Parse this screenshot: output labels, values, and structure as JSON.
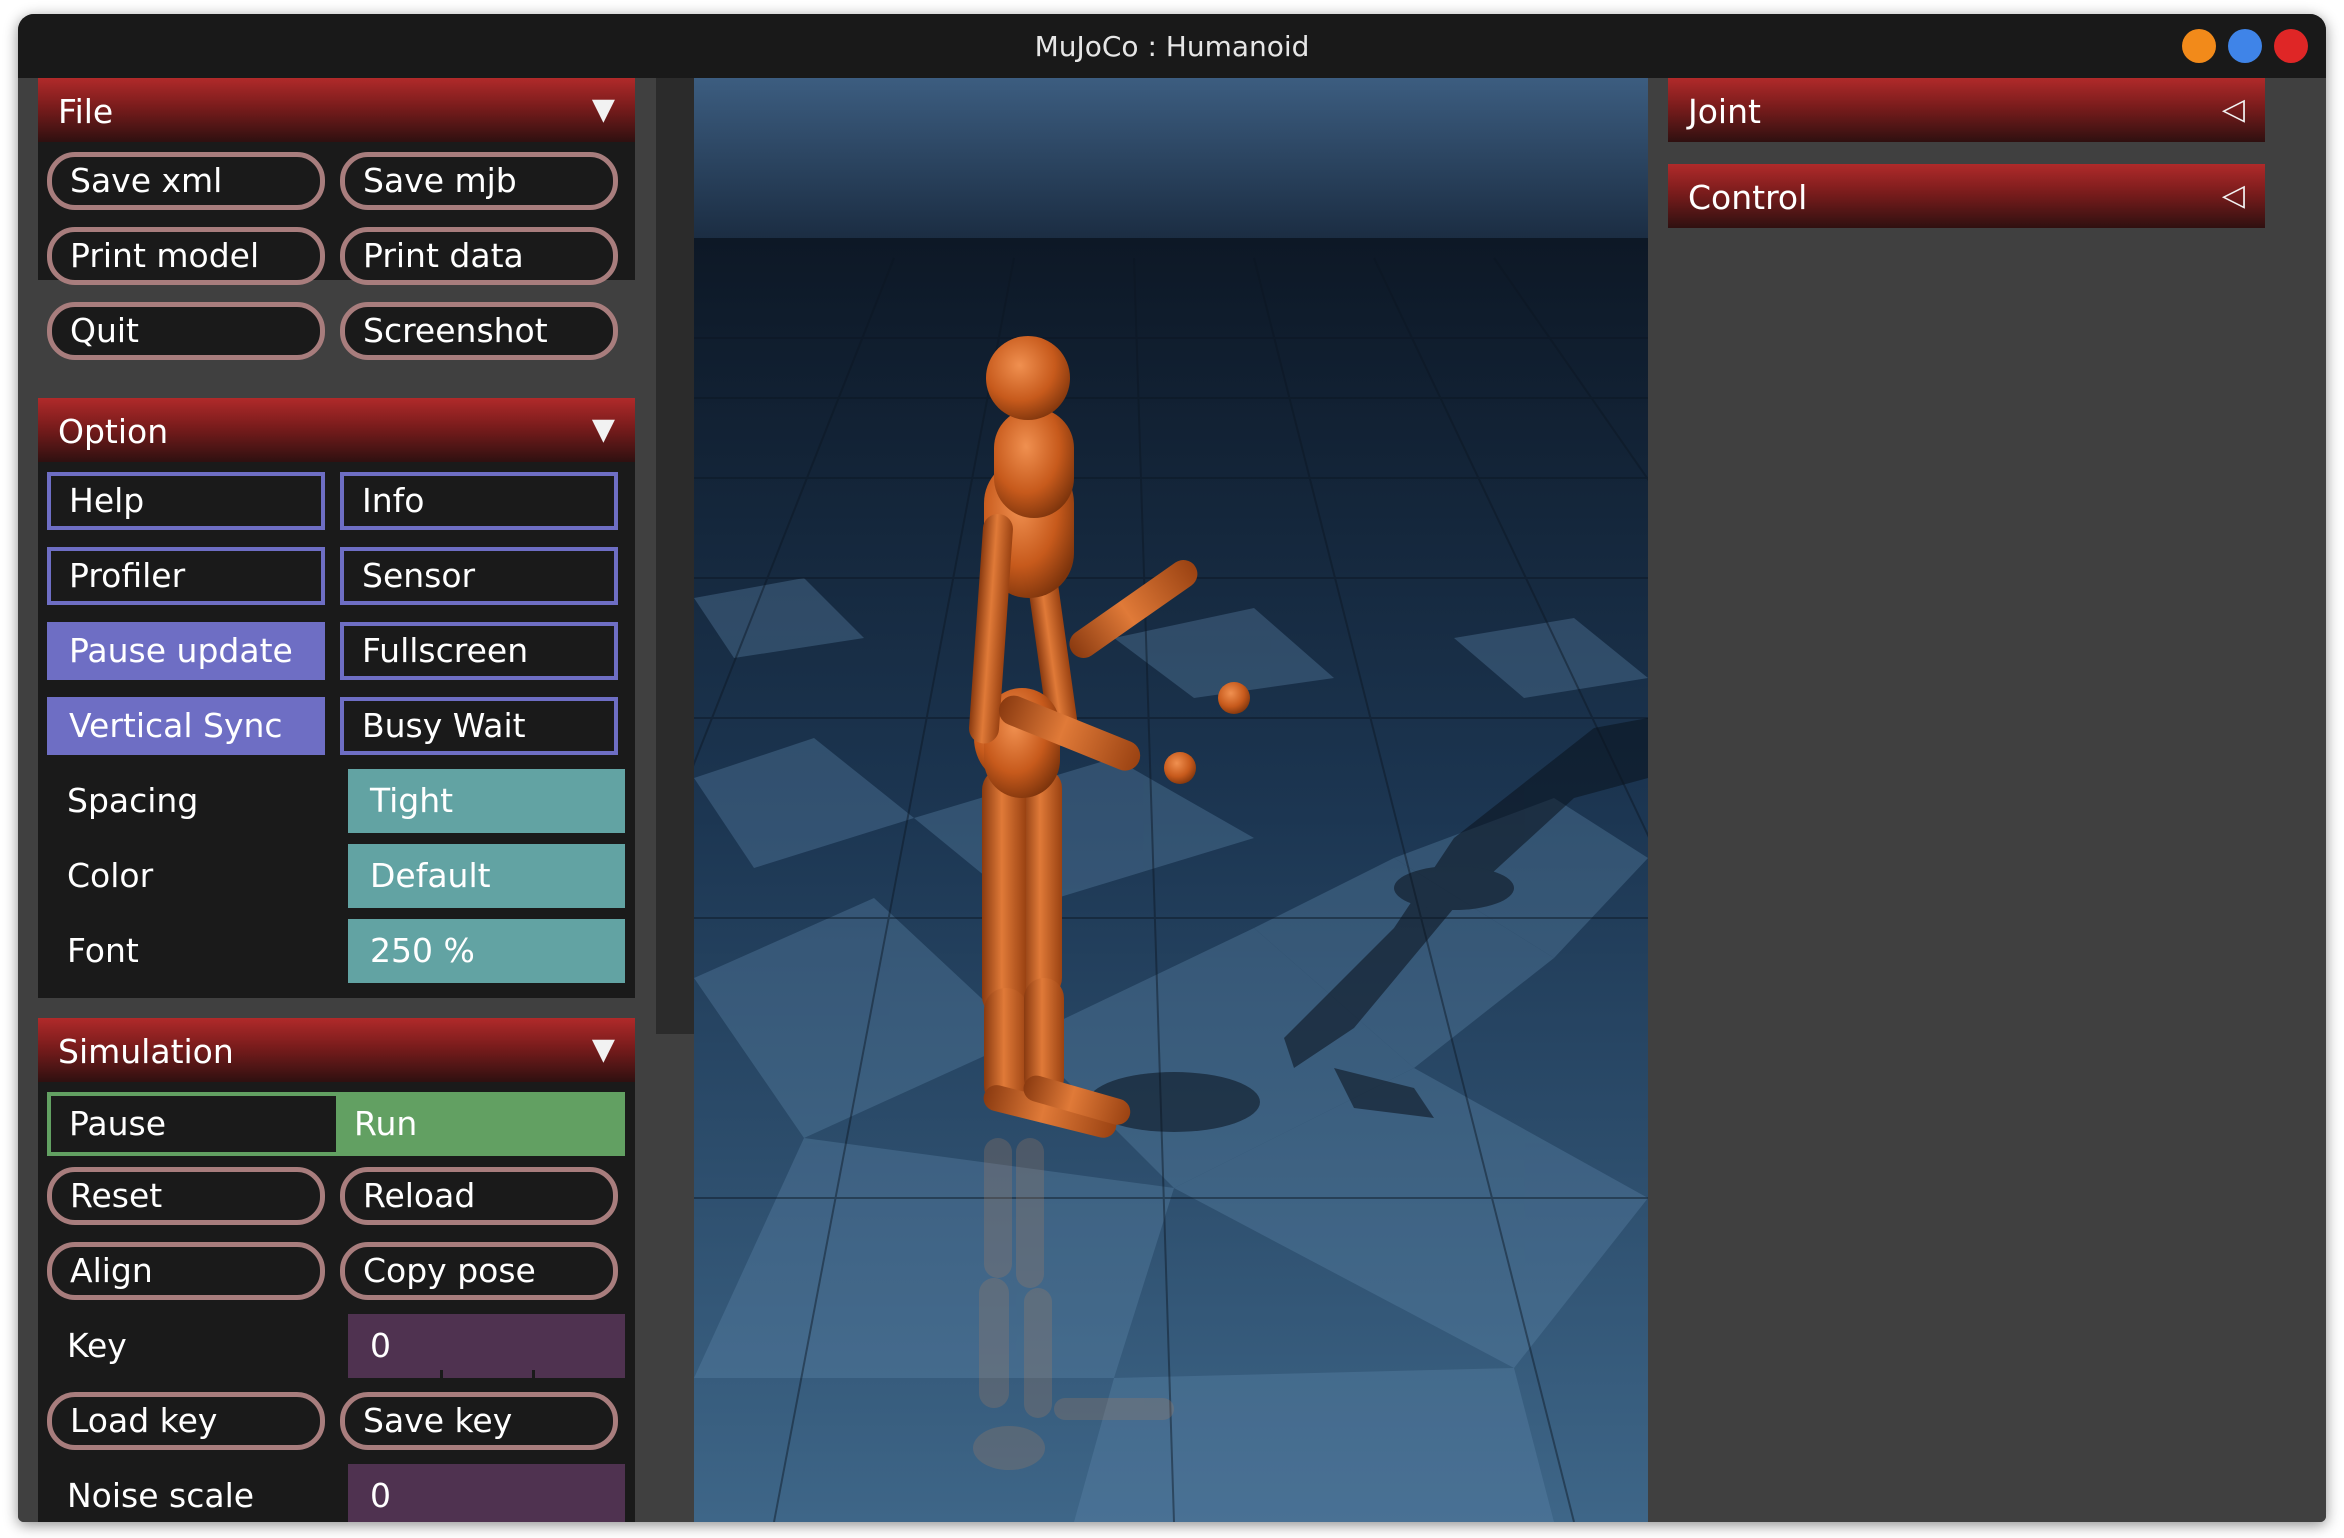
{
  "window": {
    "title": "MuJoCo : Humanoid"
  },
  "colors": {
    "section_header": "#9e2424",
    "pill_border": "#a87d7d",
    "check_border": "#6e6ec4",
    "select_bg": "#62a3a3",
    "radio_active": "#62a062",
    "field_bg": "#4f3250",
    "body_orange": "#c75a1c"
  },
  "file": {
    "title": "File",
    "save_xml": "Save xml",
    "save_mjb": "Save mjb",
    "print_model": "Print model",
    "print_data": "Print data",
    "quit": "Quit",
    "screenshot": "Screenshot"
  },
  "option": {
    "title": "Option",
    "help": "Help",
    "info": "Info",
    "profiler": "Profiler",
    "sensor": "Sensor",
    "pause_update": "Pause update",
    "fullscreen": "Fullscreen",
    "vertical_sync": "Vertical Sync",
    "busy_wait": "Busy Wait",
    "spacing_label": "Spacing",
    "spacing_value": "Tight",
    "color_label": "Color",
    "color_value": "Default",
    "font_label": "Font",
    "font_value": "250 %"
  },
  "simulation": {
    "title": "Simulation",
    "pause": "Pause",
    "run": "Run",
    "reset": "Reset",
    "reload": "Reload",
    "align": "Align",
    "copy_pose": "Copy pose",
    "key_label": "Key",
    "key_value": "0",
    "load_key": "Load key",
    "save_key": "Save key",
    "noise_scale_label": "Noise scale",
    "noise_scale_value": "0"
  },
  "right_panel": {
    "joint_title": "Joint",
    "control_title": "Control"
  },
  "icons": {
    "section_expanded": "▼",
    "section_collapsed": "◁"
  }
}
